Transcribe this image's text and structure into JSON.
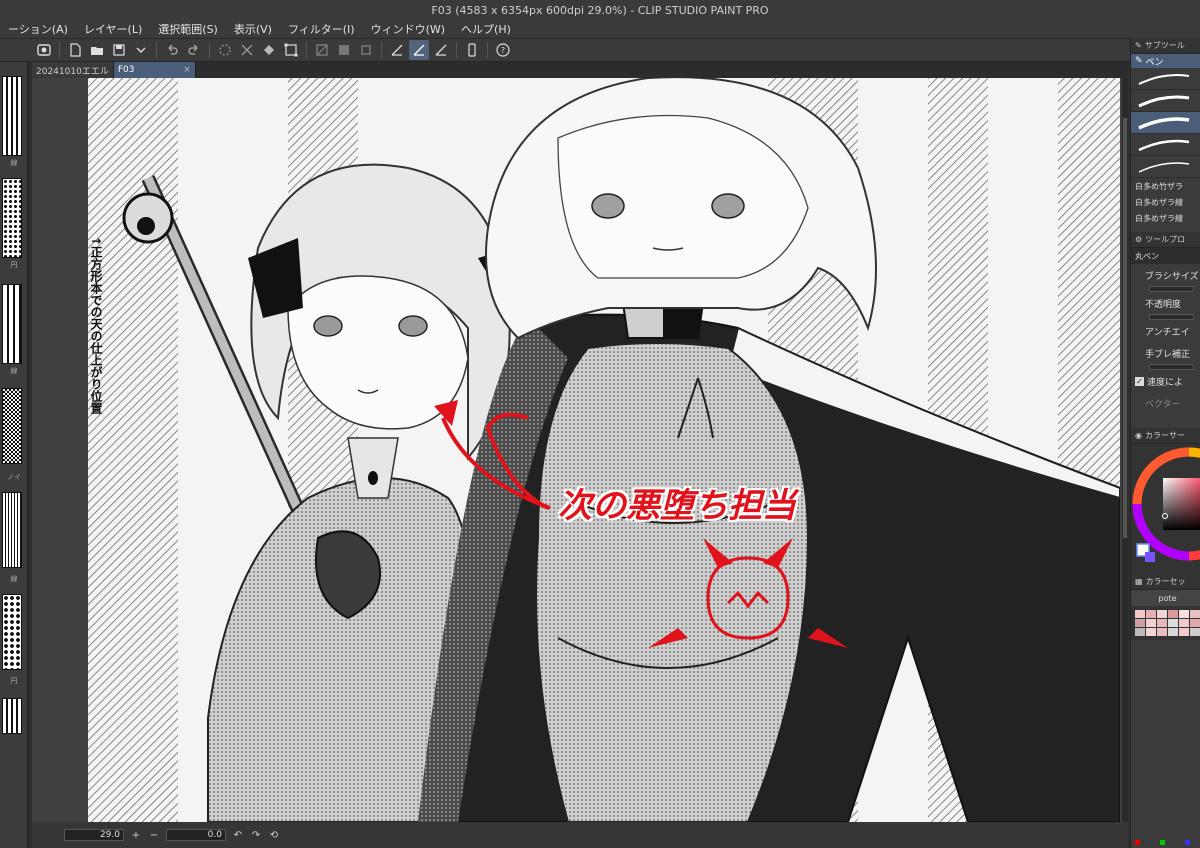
{
  "window": {
    "title": "F03 (4583 x 6354px 600dpi 29.0%) - CLIP STUDIO PAINT PRO"
  },
  "menu": {
    "items": [
      "ーション(A)",
      "レイヤー(L)",
      "選択範囲(S)",
      "表示(V)",
      "フィルター(I)",
      "ウィンドウ(W)",
      "ヘルプ(H)"
    ]
  },
  "tabs": [
    {
      "label": "20241010エエル",
      "active": false
    },
    {
      "label": "F03",
      "active": true
    }
  ],
  "canvas": {
    "note_vertical": "↑正方形本での天の仕上がり位置",
    "annotation": "次の悪堕ち担当",
    "annotation_color": "#e0121b"
  },
  "left_strip": {
    "labels": [
      "線",
      "円",
      "線",
      "ノイ",
      "線",
      "円"
    ]
  },
  "bottom_bar": {
    "zoom": "29.0",
    "angle": "0.0"
  },
  "right_panel": {
    "sub_tool_header": "サブツール",
    "active_tool": "ペン",
    "brush_names": [
      "白多め竹ザラ",
      "白多めザラ線",
      "白多めザラ線"
    ],
    "tool_property_header": "ツールプロ",
    "current_brush": "丸ペン",
    "props": {
      "brush_size": "ブラシサイズ",
      "opacity": "不透明度",
      "antialias": "アンチエイ",
      "stabilization": "手ブレ補正",
      "speed": "速度によ",
      "vector": "ベクター"
    },
    "color_header": "カラーサー",
    "palette_header": "カラーセッ",
    "palette_name": "pote"
  },
  "colors": {
    "accent": "#4a5d79",
    "annotation_red": "#e0121b"
  }
}
